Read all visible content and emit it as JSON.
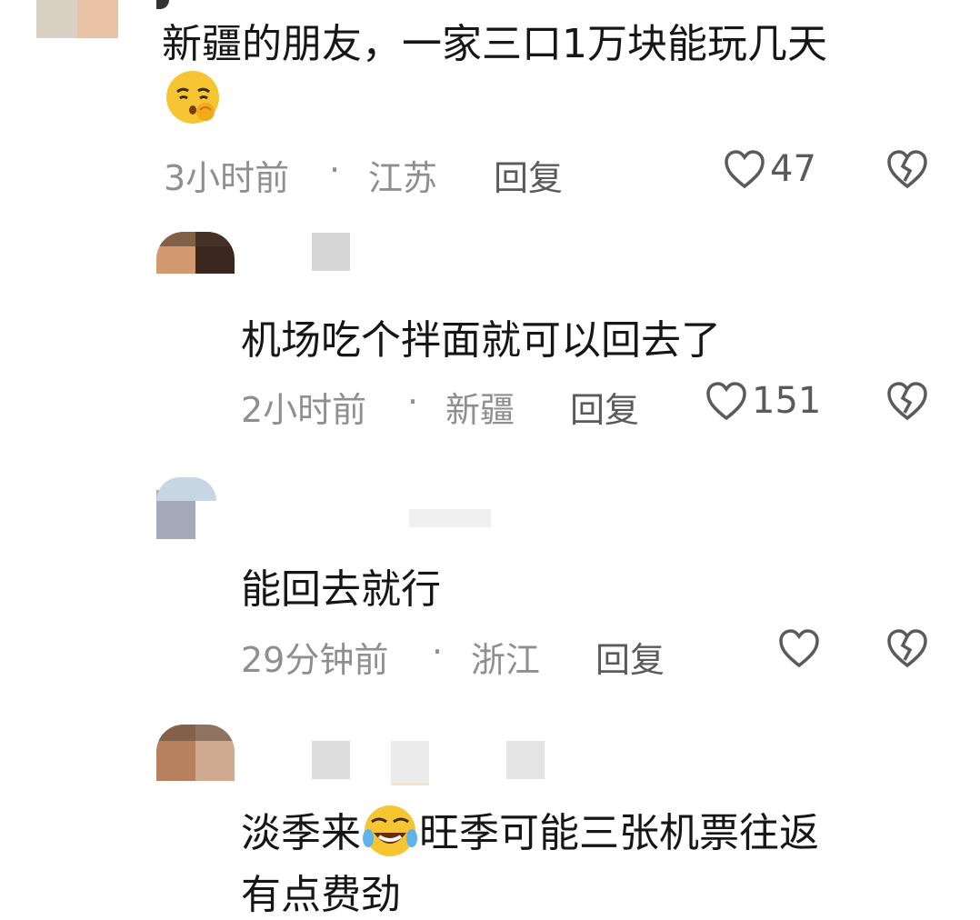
{
  "comments": [
    {
      "text": "新疆的朋友，一家三口1万块能玩几天",
      "emoji": "pleading-hush-face",
      "time": "3小时前",
      "location": "江苏",
      "reply": "回复",
      "likes": "47"
    },
    {
      "text": "机场吃个拌面就可以回去了",
      "time": "2小时前",
      "location": "新疆",
      "reply": "回复",
      "likes": "151"
    },
    {
      "text": "能回去就行",
      "time": "29分钟前",
      "location": "浙江",
      "reply": "回复",
      "likes": ""
    },
    {
      "text_part1": "淡季来",
      "emoji": "rolling-laughing-face",
      "text_part2": "旺季可能三张机票往返",
      "text_line2": "有点费劲"
    }
  ],
  "separator": "·",
  "colors": {
    "text": "#161616",
    "meta": "#8f8f8f",
    "icon": "#5a5a5a",
    "emoji": "#f7c531"
  }
}
